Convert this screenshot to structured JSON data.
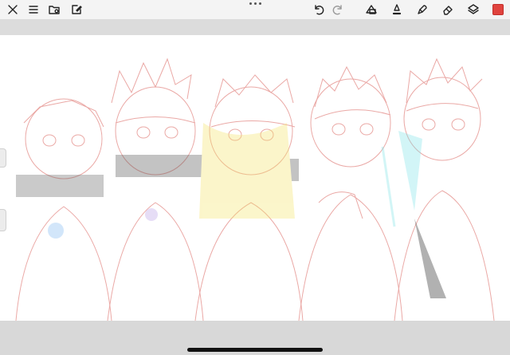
{
  "app": {
    "name": "drawing-canvas",
    "accent_color": "#e0433e",
    "current_color": "#e0433e"
  },
  "toolbar": {
    "left_icons": [
      "close-icon",
      "menu-icon",
      "gallery-icon",
      "edit-icon"
    ],
    "right_icons": [
      "undo-icon",
      "redo-icon",
      "selection-icon",
      "brush-icon",
      "smudge-icon",
      "eraser-icon",
      "layers-icon"
    ]
  },
  "canvas": {
    "content": "artwork-sketch"
  }
}
